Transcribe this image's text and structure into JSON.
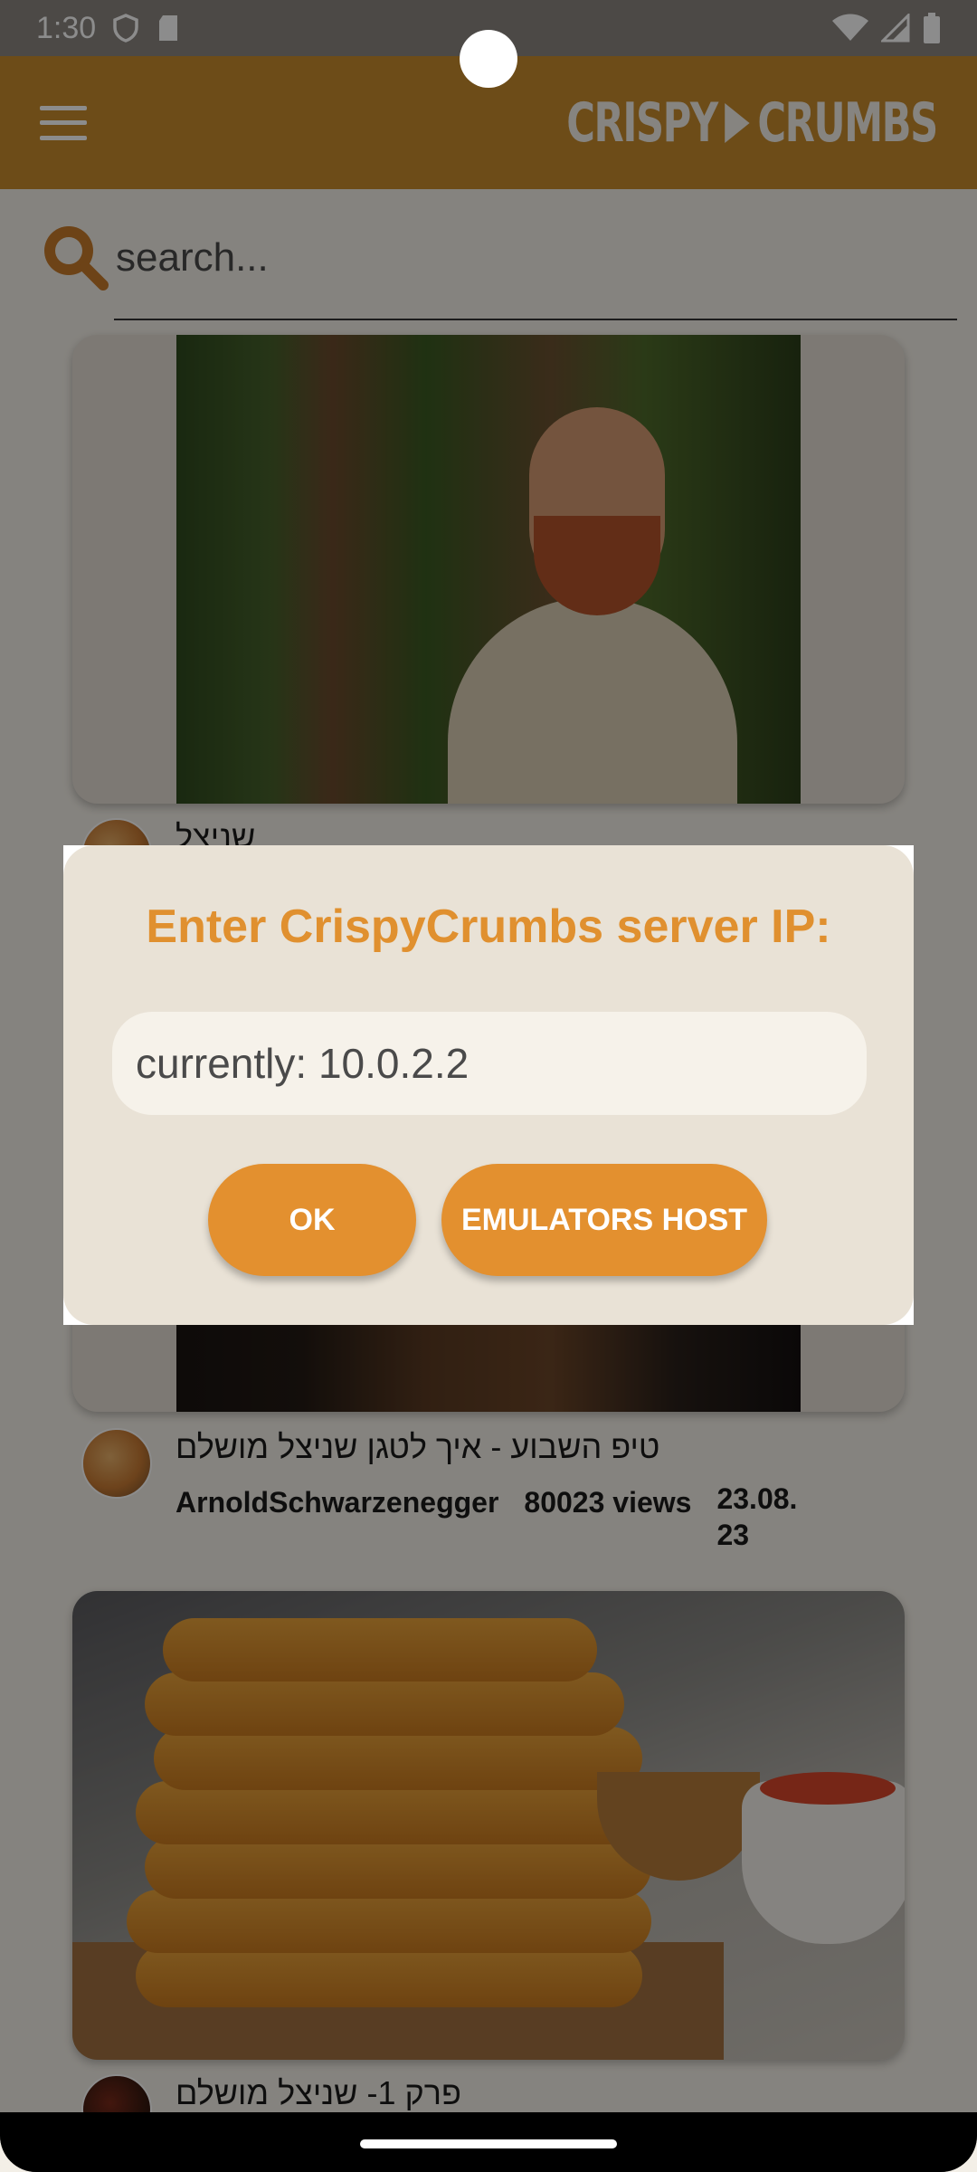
{
  "status_bar": {
    "time": "1:30",
    "left_icons": [
      "shield-icon",
      "sd-card-icon"
    ],
    "right_icons": [
      "wifi-icon",
      "signal-icon",
      "battery-icon"
    ]
  },
  "app_bar": {
    "logo_left": "CRISPY",
    "logo_right": "CRUMBS",
    "menu_icon": "hamburger-menu-icon"
  },
  "search": {
    "placeholder": "search..."
  },
  "feed": {
    "items": [
      {
        "title": "שניצל",
        "thumbnail": "cartoon-character-forest"
      },
      {
        "title": "טיפ השבוע - איך לטגן שניצל מושלם",
        "author": "ArnoldSchwarzenegger",
        "views": "80023 views",
        "date": "23.08.\n23",
        "thumbnail": "cooking-video"
      },
      {
        "title": "פרק 1- שניצל מושלם",
        "thumbnail": "schnitzel-stack"
      }
    ]
  },
  "dialog": {
    "title": "Enter CrispyCrumbs server IP:",
    "ip_placeholder": "currently: 10.0.2.2",
    "ok_label": "OK",
    "emulators_label": "EMULATORS HOST"
  },
  "colors": {
    "accent": "#E3902F",
    "app_bar": "#C68A2D",
    "dialog_bg": "#E9E2D6"
  }
}
